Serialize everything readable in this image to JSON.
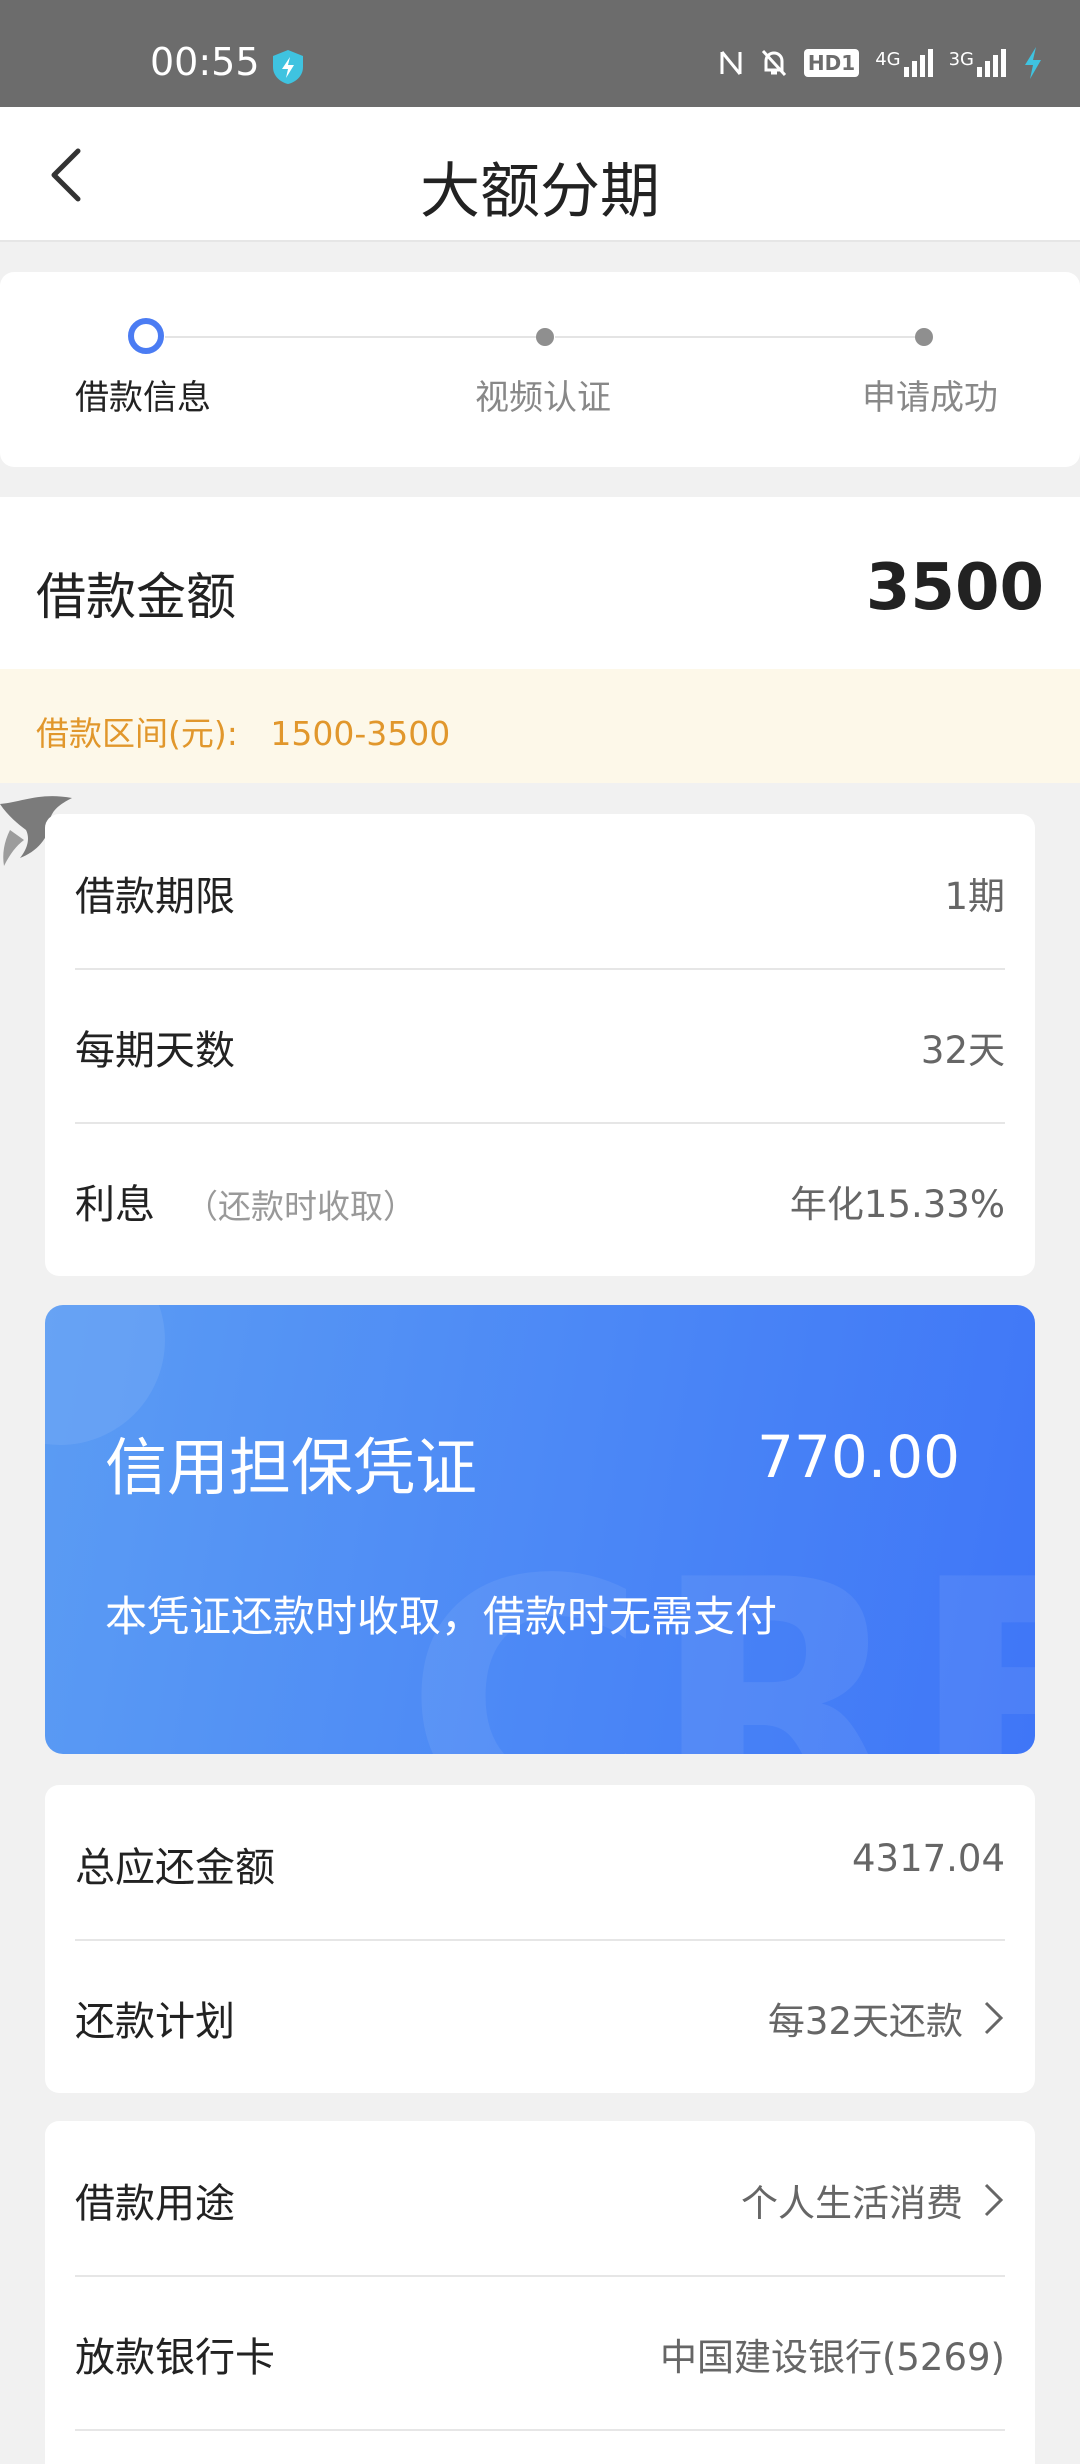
{
  "status_bar": {
    "time": "00:55",
    "icons": [
      "nfc-icon",
      "mute-icon",
      "hd-icon",
      "signal-4g-icon",
      "signal-3g-icon",
      "charging-icon"
    ],
    "hd_label": "HD1",
    "net1_label": "4G",
    "net2_label": "3G"
  },
  "nav": {
    "title": "大额分期"
  },
  "steps": [
    {
      "label": "借款信息",
      "active": true
    },
    {
      "label": "视频认证",
      "active": false
    },
    {
      "label": "申请成功",
      "active": false
    }
  ],
  "amount": {
    "label": "借款金额",
    "value": "3500"
  },
  "range": {
    "label": "借款区间(元):",
    "value": "1500-3500"
  },
  "loan_terms": {
    "term_label": "借款期限",
    "term_value": "1期",
    "days_label": "每期天数",
    "days_value": "32天",
    "interest_label": "利息",
    "interest_note": "（还款时收取）",
    "interest_value": "年化15.33%"
  },
  "credit_card": {
    "title": "信用担保凭证",
    "amount": "770.00",
    "note": "本凭证还款时收取，借款时无需支付",
    "watermark": "CRE"
  },
  "repayment": {
    "total_label": "总应还金额",
    "total_value": "4317.04",
    "plan_label": "还款计划",
    "plan_value": "每32天还款"
  },
  "purpose": {
    "purpose_label": "借款用途",
    "purpose_value": "个人生活消费",
    "bank_label": "放款银行卡",
    "bank_value": "中国建设银行(5269)"
  },
  "colors": {
    "accent": "#4b7cf3",
    "range_text": "#e1972c",
    "range_bg": "#fdf8e9"
  }
}
